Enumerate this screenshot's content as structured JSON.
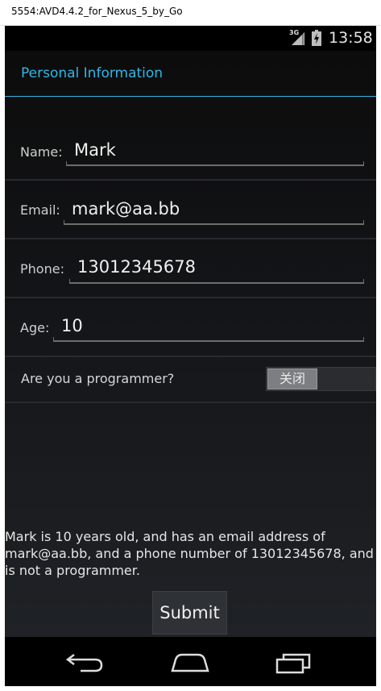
{
  "window": {
    "title": "5554:AVD4.4.2_for_Nexus_5_by_Go"
  },
  "status_bar": {
    "network": "3G",
    "time": "13:58"
  },
  "action_bar": {
    "title": "Personal Information"
  },
  "form": {
    "name": {
      "label": "Name:",
      "value": "Mark"
    },
    "email": {
      "label": "Email:",
      "value": "mark@aa.bb"
    },
    "phone": {
      "label": "Phone:",
      "value": "13012345678"
    },
    "age": {
      "label": "Age:",
      "value": "10"
    },
    "programmer": {
      "label": "Are you a programmer?",
      "toggle_text": "关闭",
      "checked": false
    }
  },
  "summary": "Mark is 10 years old, and has an email address of mark@aa.bb, and a phone number of 13012345678, and is not a programmer.",
  "submit_label": "Submit",
  "colors": {
    "accent": "#33b5e5",
    "background": "#1a1c1f"
  },
  "nav_icons": [
    "back-icon",
    "home-icon",
    "recent-apps-icon"
  ]
}
